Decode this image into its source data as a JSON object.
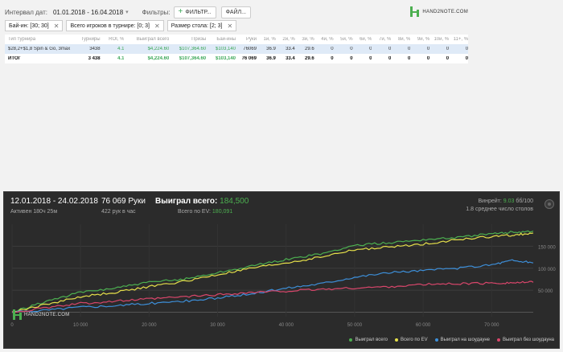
{
  "filterbar": {
    "date_label": "Интервал дат:",
    "date_value": "01.01.2018 - 16.04.2018",
    "filters_label": "Фильтры:",
    "filter_button": "ФИЛЬТР...",
    "file_button": "ФАЙЛ..."
  },
  "logo": {
    "text": "HAND2NOTE.COM"
  },
  "chips": [
    {
      "label": "Бай-ин: [30; 30]"
    },
    {
      "label": "Всего игроков в турнире: [0; 3]"
    },
    {
      "label": "Размер стола: [2; 3]"
    }
  ],
  "table": {
    "headers": [
      "Тип турнира",
      "Турниры",
      "ROI, %",
      "Выиграл всего",
      "Призы",
      "Бай-ины",
      "Руки",
      "1й, %",
      "2й, %",
      "3й, %",
      "4й, %",
      "5й, %",
      "6й, %",
      "7й, %",
      "8й, %",
      "9й, %",
      "10й, %",
      "11+, %"
    ],
    "row": [
      "$28,2+$1,8 Spin & Go, 3max",
      "3438",
      "4.1",
      "$4,224.60",
      "$107,364.60",
      "$103,140",
      "76069",
      "36.9",
      "33.4",
      "29.6",
      "0",
      "0",
      "0",
      "0",
      "0",
      "0",
      "0",
      "0"
    ],
    "total": [
      "ИТОГ",
      "3 438",
      "4.1",
      "$4,224.60",
      "$107,364.60",
      "$103,140",
      "76 069",
      "36.9",
      "33.4",
      "29.6",
      "0",
      "0",
      "0",
      "0",
      "0",
      "0",
      "0",
      "0"
    ]
  },
  "panel": {
    "date_range": "12.01.2018 - 24.02.2018",
    "active": "Активен 180ч 25м",
    "hands": "76 069 Руки",
    "rate": "422 рук в час",
    "won_label": "Выиграл всего:",
    "won_value": "184,500",
    "ev_label": "Всего по EV:",
    "ev_value": "180,091",
    "winrate_label": "Винрейт:",
    "winrate_value": "9.03",
    "winrate_suffix": "бб/100",
    "tables": "1.8 среднее число столов"
  },
  "chart_data": {
    "type": "line",
    "x_ticks": [
      "0",
      "10 000",
      "20 000",
      "30 000",
      "40 000",
      "50 000",
      "60 000",
      "70 000"
    ],
    "y_ticks": [
      "50 000",
      "100 000",
      "150 000"
    ],
    "xlim": [
      0,
      76069
    ],
    "ylim": [
      -10000,
      200000
    ],
    "series": [
      {
        "name": "Выиграл всего",
        "color": "#4caf50",
        "x": [
          0,
          5000,
          10000,
          15000,
          20000,
          25000,
          30000,
          35000,
          40000,
          45000,
          50000,
          55000,
          60000,
          65000,
          70000,
          73000,
          76069
        ],
        "y": [
          0,
          25000,
          45000,
          55000,
          68000,
          75000,
          90000,
          105000,
          120000,
          132000,
          152000,
          158000,
          165000,
          170000,
          178000,
          182000,
          184500
        ]
      },
      {
        "name": "Всего по EV",
        "color": "#e6e04a",
        "x": [
          0,
          5000,
          10000,
          15000,
          20000,
          25000,
          30000,
          35000,
          40000,
          45000,
          50000,
          55000,
          60000,
          65000,
          70000,
          73000,
          76069
        ],
        "y": [
          0,
          18000,
          35000,
          45000,
          58000,
          70000,
          85000,
          100000,
          112000,
          125000,
          142000,
          148000,
          155000,
          165000,
          172000,
          175000,
          180091
        ]
      },
      {
        "name": "Выиграл на шоудауне",
        "color": "#3d8fd9",
        "x": [
          0,
          5000,
          10000,
          15000,
          20000,
          25000,
          30000,
          35000,
          40000,
          45000,
          50000,
          55000,
          60000,
          65000,
          70000,
          73000,
          76069
        ],
        "y": [
          0,
          5000,
          12000,
          15000,
          20000,
          25000,
          32000,
          42000,
          55000,
          65000,
          80000,
          90000,
          95000,
          100000,
          108000,
          118000,
          112000
        ]
      },
      {
        "name": "Выиграл без шоудауна",
        "color": "#d9466b",
        "x": [
          0,
          5000,
          10000,
          15000,
          20000,
          25000,
          30000,
          35000,
          40000,
          45000,
          50000,
          55000,
          60000,
          65000,
          70000,
          73000,
          76069
        ],
        "y": [
          0,
          10000,
          20000,
          25000,
          30000,
          35000,
          40000,
          45000,
          48000,
          52000,
          55000,
          58000,
          63000,
          65000,
          66000,
          67000,
          68000
        ]
      }
    ]
  }
}
